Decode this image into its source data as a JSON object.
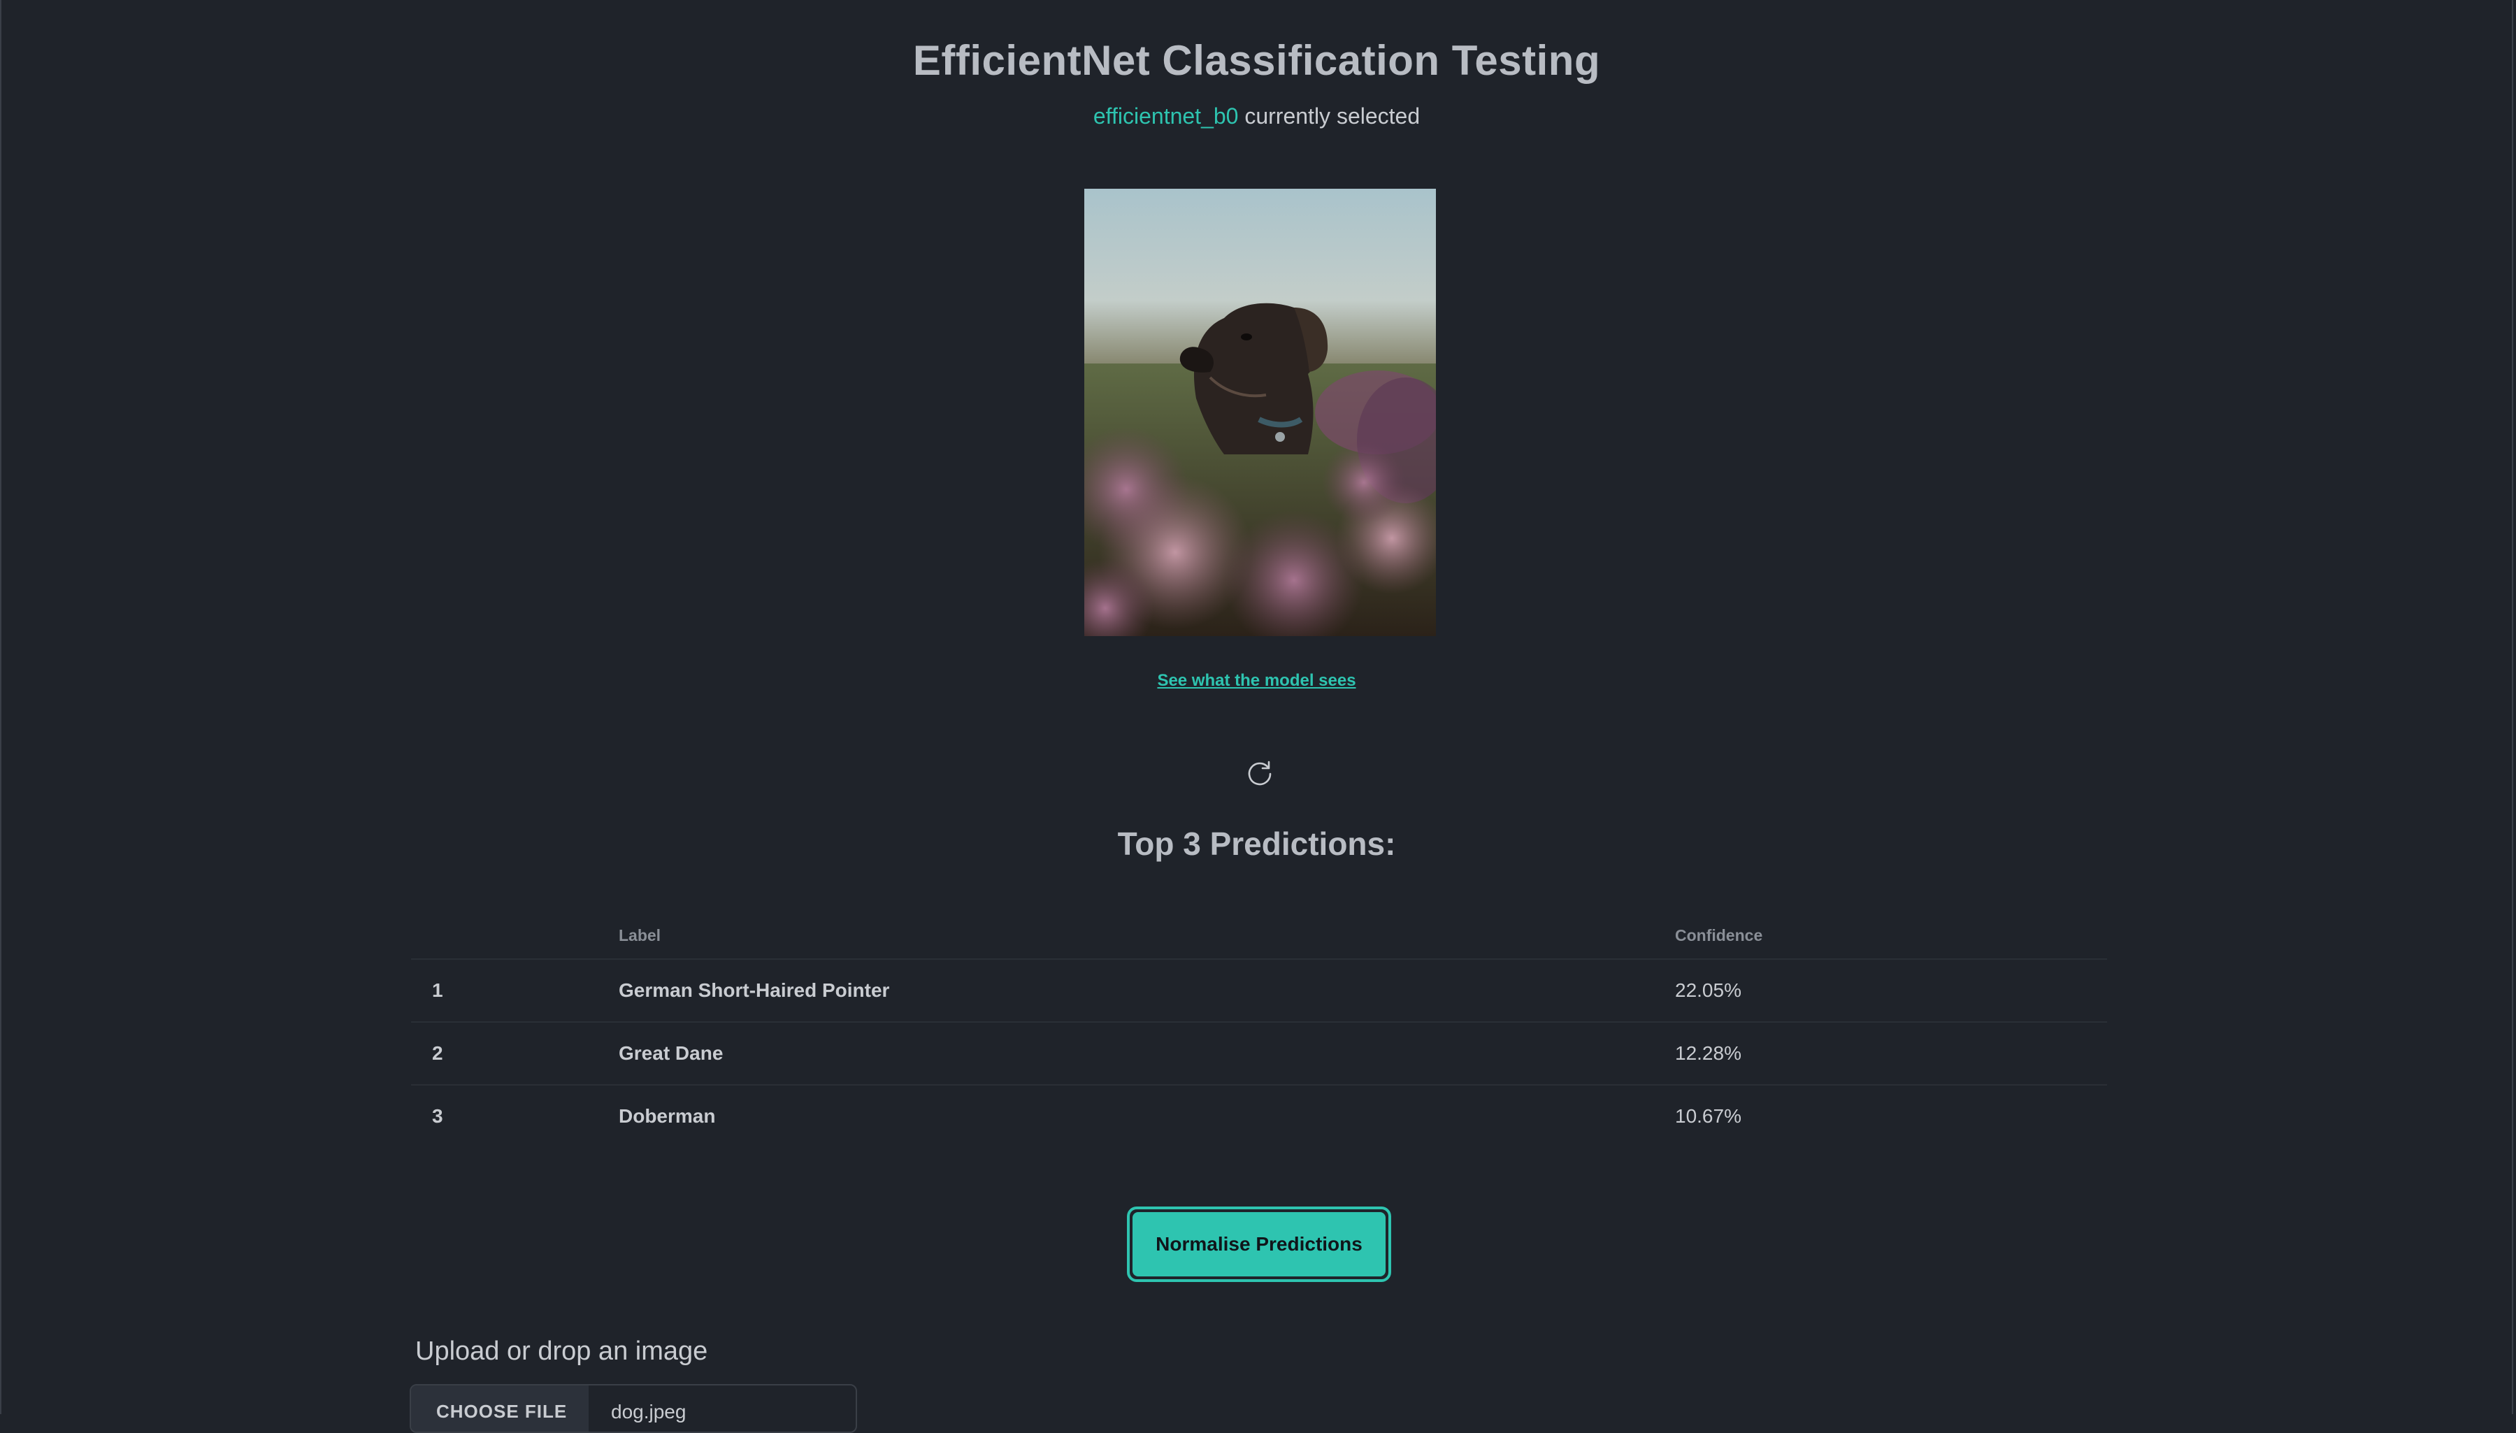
{
  "header": {
    "title": "EfficientNet Classification Testing",
    "model_name": "efficientnet_b0",
    "model_suffix": "currently selected"
  },
  "image": {
    "alt": "dog in flower field",
    "link_text": "See what the model sees"
  },
  "predictions": {
    "title": "Top 3 Predictions:",
    "columns": {
      "rank": "",
      "label": "Label",
      "confidence": "Confidence"
    },
    "rows": [
      {
        "rank": "1",
        "label": "German Short-Haired Pointer",
        "confidence": "22.05%"
      },
      {
        "rank": "2",
        "label": "Great Dane",
        "confidence": "12.28%"
      },
      {
        "rank": "3",
        "label": "Doberman",
        "confidence": "10.67%"
      }
    ]
  },
  "actions": {
    "normalise_label": "Normalise Predictions"
  },
  "upload": {
    "label": "Upload or drop an image",
    "choose_file_label": "CHOOSE FILE",
    "file_name": "dog.jpeg"
  },
  "colors": {
    "background": "#1f232a",
    "accent": "#2ec4b0",
    "text": "#c9ccd1"
  }
}
